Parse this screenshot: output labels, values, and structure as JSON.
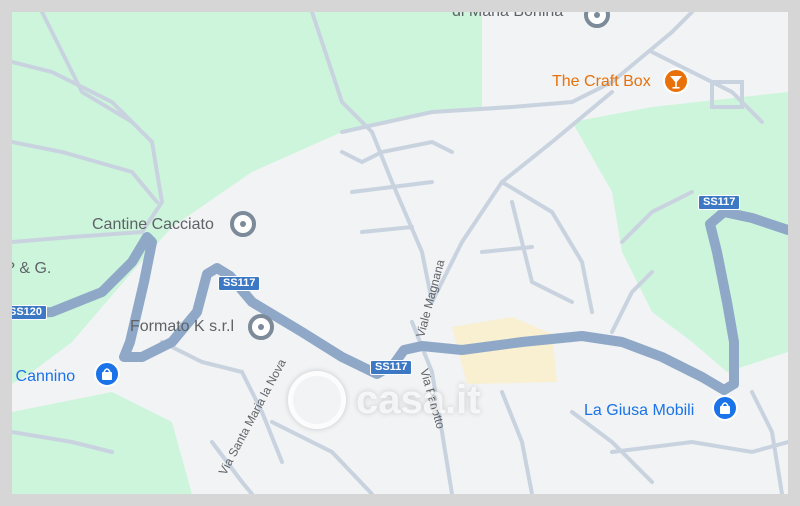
{
  "map": {
    "pois": [
      {
        "id": "maria-bonina",
        "name": "di Maria Bonina",
        "category": "gray",
        "icon": "pin-gray-icon"
      },
      {
        "id": "craft-box",
        "name": "The Craft Box",
        "category": "bar",
        "icon": "cocktail-icon",
        "color": "#e8710a"
      },
      {
        "id": "cantine",
        "name": "Cantine Cacciato",
        "category": "gray",
        "icon": "pin-gray-icon"
      },
      {
        "id": "rg",
        "name": "? & G.",
        "category": "gray",
        "icon": ""
      },
      {
        "id": "formato",
        "name": "Formato K s.r.l",
        "category": "gray",
        "icon": "pin-gray-icon"
      },
      {
        "id": "cannino",
        "name": "li Cannino",
        "category": "shopping",
        "icon": "shopping-bag-icon",
        "color": "#1a73e8"
      },
      {
        "id": "giusa",
        "name": "La Giusa Mobili",
        "category": "shopping",
        "icon": "shopping-bag-icon",
        "color": "#1a73e8"
      }
    ],
    "road_shields": {
      "ss117_a": "SS117",
      "ss117_b": "SS117",
      "ss117_c": "SS117",
      "ss120": "SS120"
    },
    "streets": {
      "viale_magnana": "Viale Magnana",
      "via_santa_maria": "Via Santa Maria la Nova",
      "via_panotto": "Via Panotto"
    },
    "watermark": "casa.it",
    "colors": {
      "land": "#f1f3f4",
      "park": "#cdf5dc",
      "highway": "#8fa8c8",
      "road": "#c9d3df",
      "building_zone": "#fbefc8"
    }
  }
}
